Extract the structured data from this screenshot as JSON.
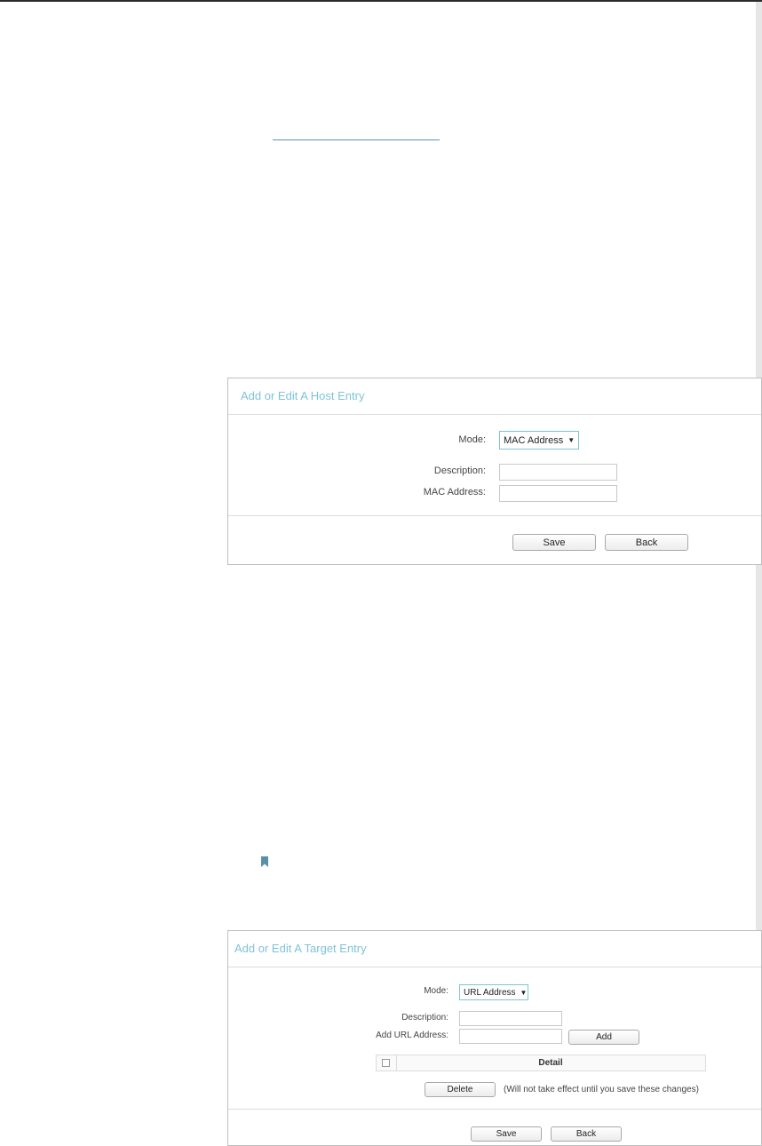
{
  "host_entry": {
    "title": "Add or Edit A Host Entry",
    "mode_label": "Mode:",
    "mode_value": "MAC Address",
    "description_label": "Description:",
    "description_value": "",
    "mac_label": "MAC Address:",
    "mac_value": "",
    "save_label": "Save",
    "back_label": "Back"
  },
  "target_entry": {
    "title": "Add or Edit A Target Entry",
    "mode_label": "Mode:",
    "mode_value": "URL Address",
    "description_label": "Description:",
    "description_value": "",
    "url_label": "Add URL Address:",
    "url_value": "",
    "add_label": "Add",
    "detail_header": "Detail",
    "delete_label": "Delete",
    "delete_note": "(Will not take effect until you save these changes)",
    "save_label": "Save",
    "back_label": "Back"
  },
  "colors": {
    "accent": "#7fc3d8",
    "link": "#5a8fc4",
    "note_icon": "#5a8fa8"
  },
  "icons": {
    "note": "bookmark-icon",
    "dropdown": "caret-down-icon"
  }
}
